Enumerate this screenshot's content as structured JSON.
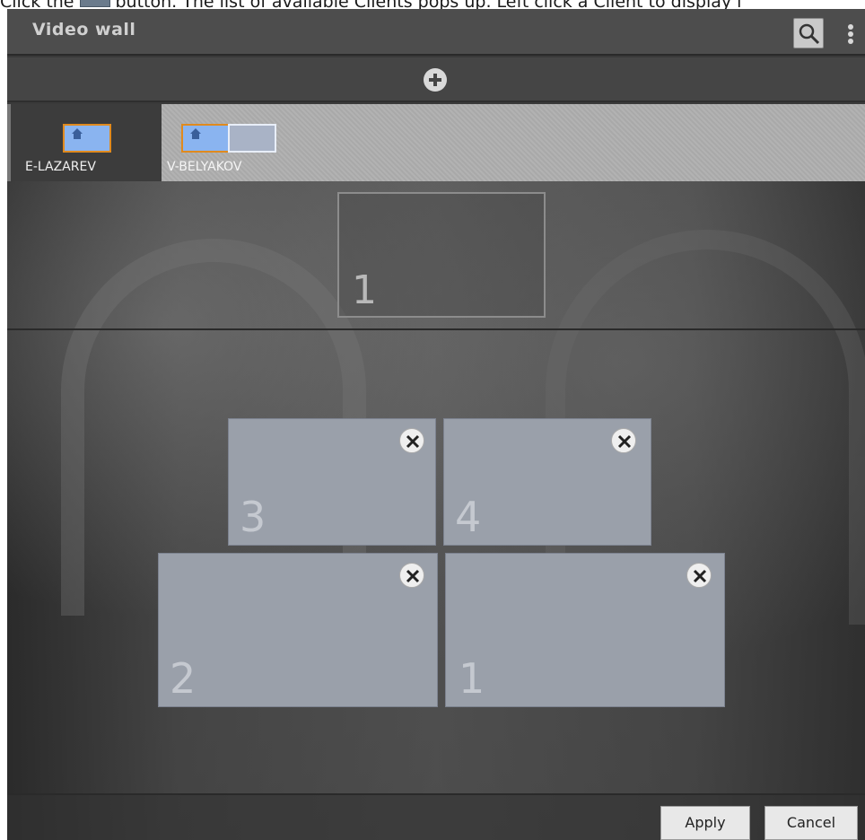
{
  "caption": {
    "prefix": "Click the",
    "suffix": "button. The list of available Clients pops up. Left click a Client to display i"
  },
  "window": {
    "title": "Video wall"
  },
  "toolbar": {
    "search_icon": "search-icon",
    "more_icon": "vertical-ellipsis-icon",
    "add_icon": "plus-circle-icon"
  },
  "clients": [
    {
      "name": "E-LAZAREV",
      "selected": true,
      "monitors": 1
    },
    {
      "name": "V-BELYAKOV",
      "selected": false,
      "monitors": 2
    }
  ],
  "preview": {
    "monitor_number": "1"
  },
  "layout": {
    "tiles": [
      {
        "number": "3"
      },
      {
        "number": "4"
      },
      {
        "number": "2"
      },
      {
        "number": "1"
      }
    ]
  },
  "footer": {
    "apply_label": "Apply",
    "cancel_label": "Cancel"
  },
  "colors": {
    "selected_border": "#e08a1e",
    "monitor_fill": "#8ab4f0",
    "tile_fill": "#9aa0aa"
  }
}
